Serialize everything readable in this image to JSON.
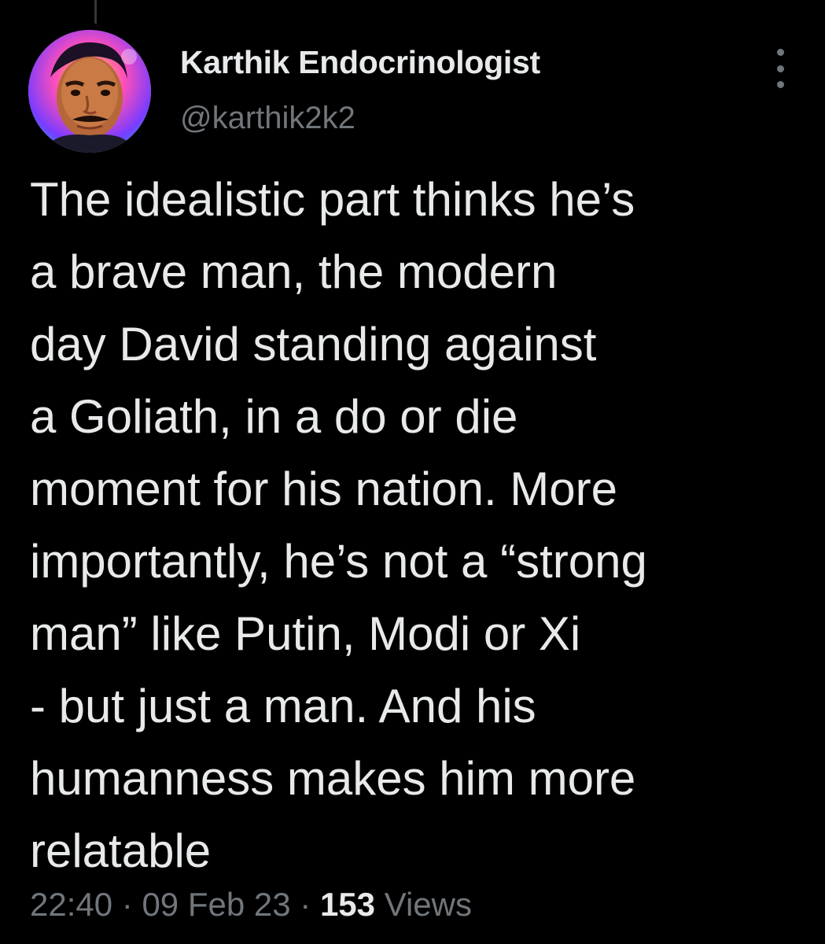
{
  "author": {
    "name": "Karthik Endocrinologist",
    "handle": "@karthik2k2"
  },
  "tweet": {
    "lines": [
      "The idealistic part thinks he’s",
      "a brave man, the modern",
      "day David standing against",
      "a Goliath, in a do or die",
      "moment for his nation. More",
      "importantly, he’s not a “strong",
      "man” like Putin, Modi or Xi",
      "- but just a man. And his",
      "humanness makes him more",
      "relatable"
    ]
  },
  "meta": {
    "time": "22:40",
    "separator": "·",
    "date": "09 Feb 23",
    "views_count": "153",
    "views_label": "Views"
  },
  "icons": {
    "more": "more-vertical-icon"
  },
  "colors": {
    "background": "#000000",
    "primary_text": "#e7e9ea",
    "secondary_text": "#71767b"
  }
}
